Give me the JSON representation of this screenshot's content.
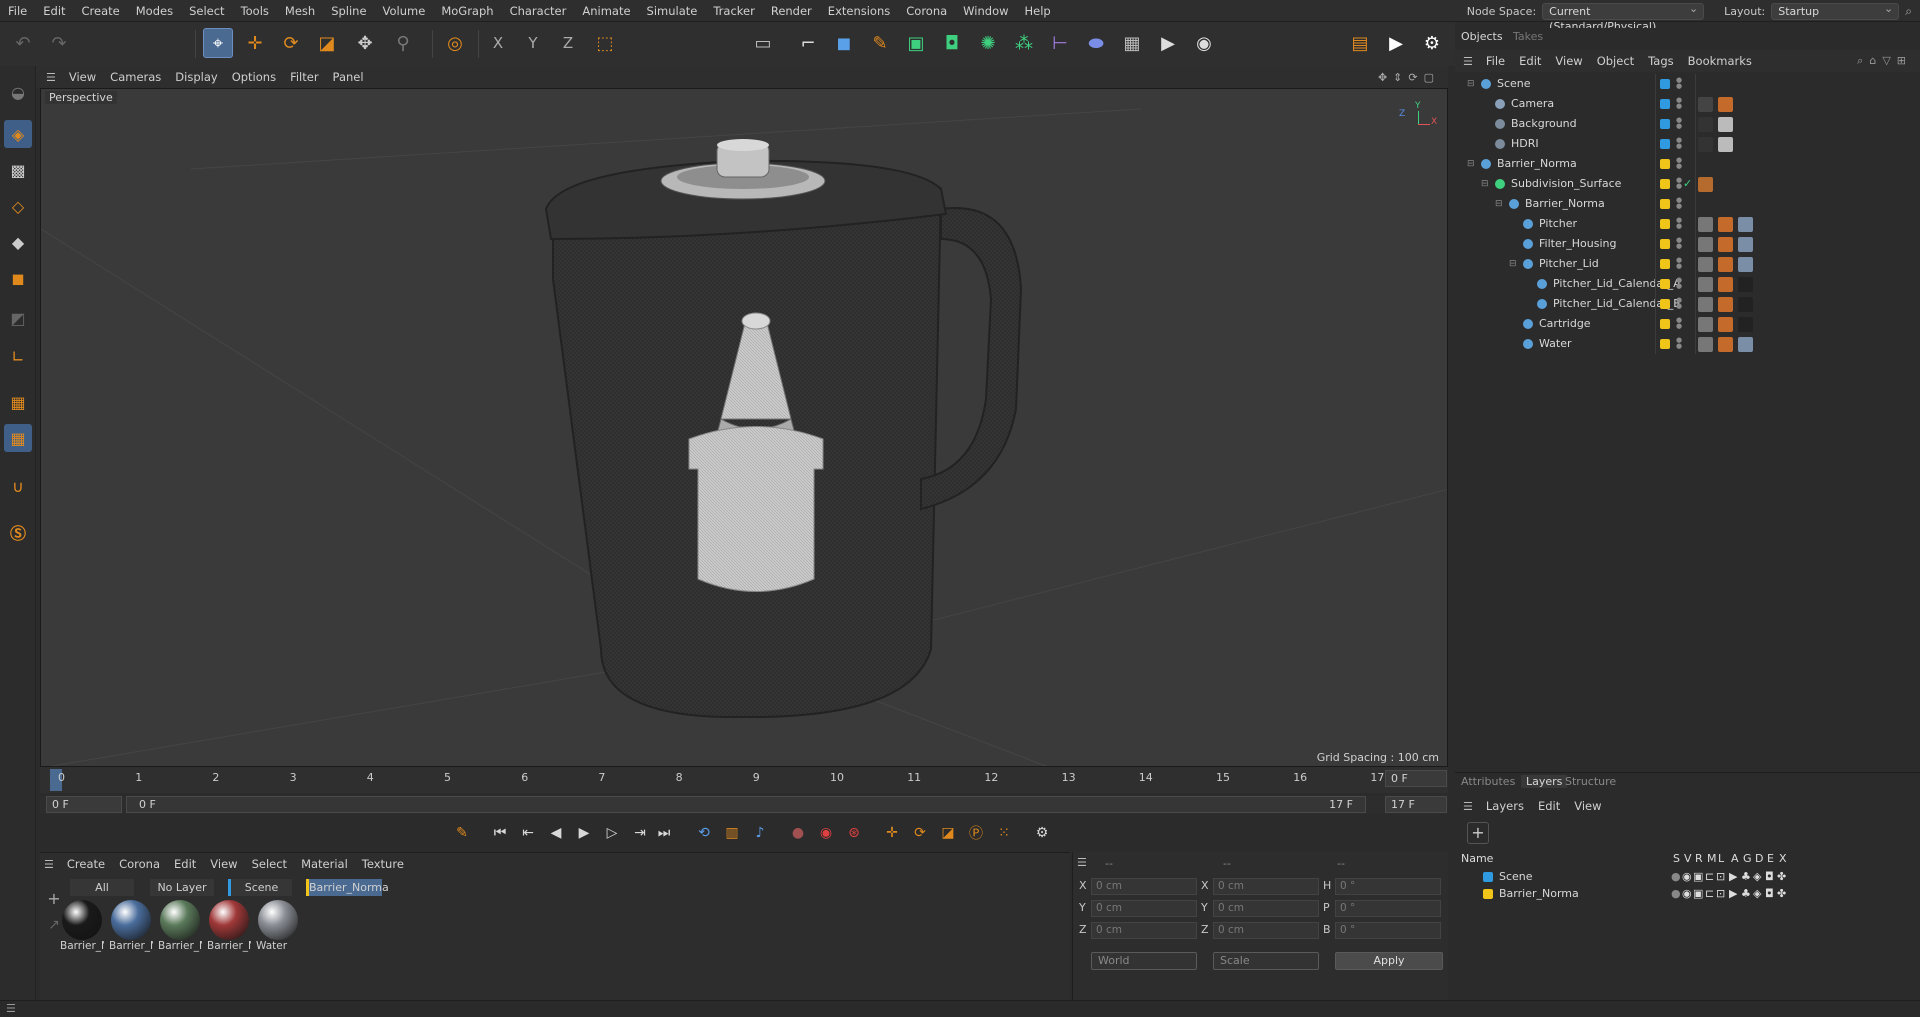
{
  "menu": [
    "File",
    "Edit",
    "Create",
    "Modes",
    "Select",
    "Tools",
    "Mesh",
    "Spline",
    "Volume",
    "MoGraph",
    "Character",
    "Animate",
    "Simulate",
    "Tracker",
    "Render",
    "Extensions",
    "Corona",
    "Window",
    "Help"
  ],
  "node_space": {
    "label": "Node Space:",
    "value": "Current (Standard/Physical)"
  },
  "layout": {
    "label": "Layout:",
    "value": "Startup"
  },
  "toolbar": {
    "axis_x": "X",
    "axis_y": "Y",
    "axis_z": "Z"
  },
  "viewport": {
    "menu": [
      "View",
      "Cameras",
      "Display",
      "Options",
      "Filter",
      "Panel"
    ],
    "label": "Perspective",
    "grid_spacing": "Grid Spacing : 100 cm",
    "axis_labels": {
      "x": "X",
      "y": "Y",
      "z": "Z"
    }
  },
  "timeline": {
    "ticks": [
      "0",
      "1",
      "2",
      "3",
      "4",
      "5",
      "6",
      "7",
      "8",
      "9",
      "10",
      "11",
      "12",
      "13",
      "14",
      "15",
      "16",
      "17"
    ],
    "end_field": "0 F",
    "start": "0 F",
    "range_start": "0 F",
    "range_end": "17 F",
    "end": "17 F"
  },
  "materials": {
    "menu": [
      "Create",
      "Corona",
      "Edit",
      "View",
      "Select",
      "Material",
      "Texture"
    ],
    "tabs": [
      "All",
      "No Layer",
      "Scene",
      "Barrier_Norma"
    ],
    "items": [
      {
        "label": "Barrier_N",
        "color": "#1a1a1a"
      },
      {
        "label": "Barrier_N",
        "color": "#4a6d9c"
      },
      {
        "label": "Barrier_N",
        "color": "#5b7a5b"
      },
      {
        "label": "Barrier_N",
        "color": "#a03838"
      },
      {
        "label": "Water",
        "color": "#8a8e95"
      }
    ]
  },
  "coords": {
    "headers": [
      "--",
      "--",
      "--"
    ],
    "rows": [
      {
        "a": "X",
        "av": "0 cm",
        "b": "X",
        "bv": "0 cm",
        "c": "H",
        "cv": "0 °"
      },
      {
        "a": "Y",
        "av": "0 cm",
        "b": "Y",
        "bv": "0 cm",
        "c": "P",
        "cv": "0 °"
      },
      {
        "a": "Z",
        "av": "0 cm",
        "b": "Z",
        "bv": "0 cm",
        "c": "B",
        "cv": "0 °"
      }
    ],
    "space": "World",
    "mode": "Scale",
    "apply": "Apply"
  },
  "objects_panel": {
    "tabs": [
      "Objects",
      "Takes"
    ],
    "menu": [
      "File",
      "Edit",
      "View",
      "Object",
      "Tags",
      "Bookmarks"
    ],
    "items": [
      {
        "name": "Scene",
        "color": "#2f9ae0",
        "icon": "#5aa0d8"
      },
      {
        "name": "Camera",
        "color": "#2f9ae0",
        "icon": "#8aa0b8"
      },
      {
        "name": "Background",
        "color": "#2f9ae0",
        "icon": "#7c8c9c"
      },
      {
        "name": "HDRI",
        "color": "#2f9ae0",
        "icon": "#7c8c9c"
      },
      {
        "name": "Barrier_Norma",
        "color": "#f0c419",
        "icon": "#5aa0d8"
      },
      {
        "name": "Subdivision_Surface",
        "color": "#f0c419",
        "icon": "#3fd07f"
      },
      {
        "name": "Barrier_Norma",
        "color": "#f0c419",
        "icon": "#5aa0d8"
      },
      {
        "name": "Pitcher",
        "color": "#f0c419",
        "icon": "#5aa0d8"
      },
      {
        "name": "Filter_Housing",
        "color": "#f0c419",
        "icon": "#5aa0d8"
      },
      {
        "name": "Pitcher_Lid",
        "color": "#f0c419",
        "icon": "#5aa0d8"
      },
      {
        "name": "Pitcher_Lid_Calendar_A",
        "color": "#f0c419",
        "icon": "#5aa0d8"
      },
      {
        "name": "Pitcher_Lid_Calendar_B",
        "color": "#f0c419",
        "icon": "#5aa0d8"
      },
      {
        "name": "Cartridge",
        "color": "#f0c419",
        "icon": "#5aa0d8"
      },
      {
        "name": "Water",
        "color": "#f0c419",
        "icon": "#5aa0d8"
      }
    ]
  },
  "layers_panel": {
    "tabs": [
      "Attributes",
      "Layers",
      "Structure"
    ],
    "menu": [
      "Layers",
      "Edit",
      "View"
    ],
    "columns": [
      "Name",
      "S",
      "V",
      "R",
      "M",
      "L",
      "A",
      "G",
      "D",
      "E",
      "X"
    ],
    "items": [
      {
        "name": "Scene",
        "color": "#2f9ae0"
      },
      {
        "name": "Barrier_Norma",
        "color": "#f0c419"
      }
    ]
  }
}
